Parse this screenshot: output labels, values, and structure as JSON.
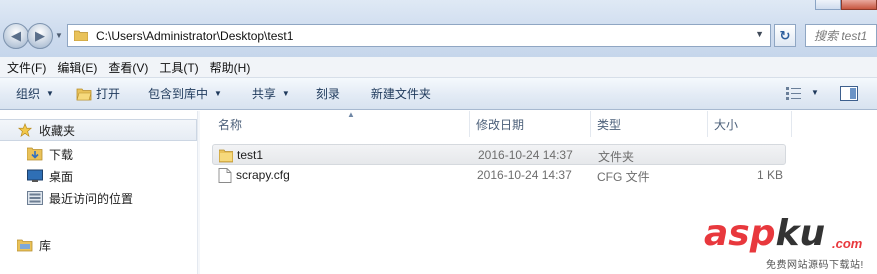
{
  "address_bar": {
    "path": "C:\\Users\\Administrator\\Desktop\\test1",
    "search_placeholder": "搜索 test1"
  },
  "menu": [
    "文件(F)",
    "编辑(E)",
    "查看(V)",
    "工具(T)",
    "帮助(H)"
  ],
  "toolbar": {
    "organize": "组织",
    "open": "打开",
    "include_in_library": "包含到库中",
    "share": "共享",
    "burn": "刻录",
    "new_folder": "新建文件夹"
  },
  "nav": {
    "favorites": "收藏夹",
    "downloads": "下载",
    "desktop": "桌面",
    "recent": "最近访问的位置",
    "libraries": "库"
  },
  "columns": [
    "名称",
    "修改日期",
    "类型",
    "大小"
  ],
  "files": [
    {
      "name": "test1",
      "modified": "2016-10-24 14:37",
      "type": "文件夹",
      "size": ""
    },
    {
      "name": "scrapy.cfg",
      "modified": "2016-10-24 14:37",
      "type": "CFG 文件",
      "size": "1 KB"
    }
  ],
  "watermark": {
    "brand_red": "asp",
    "brand_dark": "ku",
    "dotcom": ".com",
    "subtitle": "免费网站源码下载站!"
  },
  "colors": {
    "chrome_blue": "#cddbee",
    "toolbar_text": "#1e395b",
    "watermark_red": "#e8383d"
  }
}
